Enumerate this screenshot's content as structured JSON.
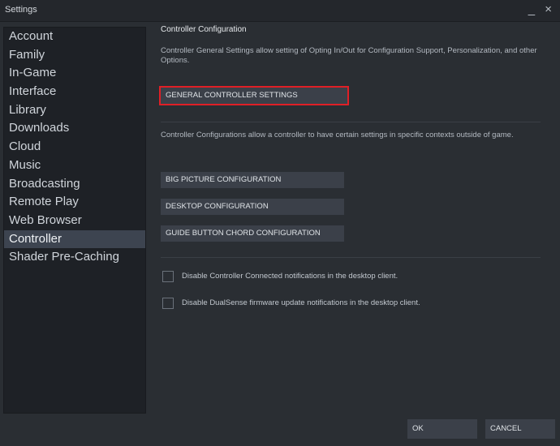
{
  "window": {
    "title": "Settings",
    "minimize": "_",
    "close": "×"
  },
  "sidebar": {
    "items": [
      {
        "label": "Account"
      },
      {
        "label": "Family"
      },
      {
        "label": "In-Game"
      },
      {
        "label": "Interface"
      },
      {
        "label": "Library"
      },
      {
        "label": "Downloads"
      },
      {
        "label": "Cloud"
      },
      {
        "label": "Music"
      },
      {
        "label": "Broadcasting"
      },
      {
        "label": "Remote Play"
      },
      {
        "label": "Web Browser"
      },
      {
        "label": "Controller"
      },
      {
        "label": "Shader Pre-Caching"
      }
    ],
    "active": "Controller"
  },
  "main": {
    "heading": "Controller Configuration",
    "general_desc": "Controller General Settings allow setting of Opting In/Out for Configuration Support, Personalization, and other Options.",
    "general_button": "GENERAL CONTROLLER SETTINGS",
    "config_desc": "Controller Configurations allow a controller to have certain settings in specific contexts outside of game.",
    "config_buttons": {
      "big_picture": "BIG PICTURE CONFIGURATION",
      "desktop": "DESKTOP CONFIGURATION",
      "guide_chord": "GUIDE BUTTON CHORD CONFIGURATION"
    },
    "checkboxes": {
      "connected": {
        "label": "Disable Controller Connected notifications in the desktop client.",
        "checked": false
      },
      "dualsense": {
        "label": "Disable DualSense firmware update notifications in the desktop client.",
        "checked": false
      }
    }
  },
  "footer": {
    "ok": "OK",
    "cancel": "CANCEL"
  },
  "colors": {
    "highlight": "#e01f26",
    "active_item": "#3d4450"
  }
}
